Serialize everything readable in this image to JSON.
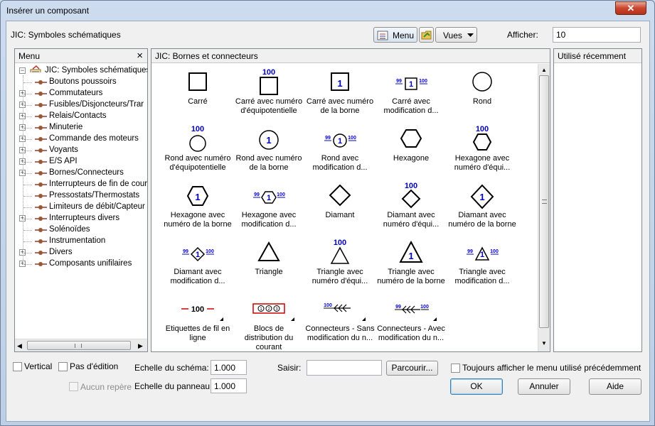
{
  "window": {
    "title": "Insérer un composant",
    "close_glyph": "✕"
  },
  "toolbar": {
    "library_label": "JIC: Symboles schématiques",
    "menu_button": "Menu",
    "views_button": "Vues",
    "show_label": "Afficher:",
    "show_value": "10"
  },
  "menu_panel": {
    "title": "Menu",
    "close_glyph": "×",
    "root": "JIC: Symboles schématiques",
    "items": [
      {
        "label": "Boutons poussoirs",
        "expandable": false
      },
      {
        "label": "Commutateurs",
        "expandable": true
      },
      {
        "label": "Fusibles/Disjoncteurs/Trar",
        "expandable": true
      },
      {
        "label": "Relais/Contacts",
        "expandable": true
      },
      {
        "label": "Minuterie",
        "expandable": true
      },
      {
        "label": "Commande des moteurs",
        "expandable": true
      },
      {
        "label": "Voyants",
        "expandable": true
      },
      {
        "label": "E/S API",
        "expandable": true
      },
      {
        "label": "Bornes/Connecteurs",
        "expandable": true
      },
      {
        "label": "Interrupteurs de fin de cour",
        "expandable": false
      },
      {
        "label": "Pressostats/Thermostats",
        "expandable": false
      },
      {
        "label": "Limiteurs de débit/Capteur",
        "expandable": false
      },
      {
        "label": "Interrupteurs divers",
        "expandable": true
      },
      {
        "label": "Solénoïdes",
        "expandable": false
      },
      {
        "label": "Instrumentation",
        "expandable": false
      },
      {
        "label": "Divers",
        "expandable": true
      },
      {
        "label": "Composants unifilaires",
        "expandable": true
      }
    ]
  },
  "symbols_panel": {
    "title": "JIC: Bornes et connecteurs",
    "symbols": [
      {
        "label": "Carré",
        "icon": "square-icon"
      },
      {
        "label": "Carré avec numéro d'équipotentielle",
        "icon": "square-100-icon"
      },
      {
        "label": "Carré avec numéro de la borne",
        "icon": "square-1-icon"
      },
      {
        "label": "Carré avec modification d...",
        "icon": "square-mod-icon"
      },
      {
        "label": "Rond",
        "icon": "circle-icon"
      },
      {
        "label": "Rond avec numéro d'équipotentielle",
        "icon": "circle-100-icon"
      },
      {
        "label": "Rond avec numéro de la borne",
        "icon": "circle-1-icon"
      },
      {
        "label": "Rond avec modification d...",
        "icon": "circle-mod-icon"
      },
      {
        "label": "Hexagone",
        "icon": "hexagon-icon"
      },
      {
        "label": "Hexagone avec numéro d'équi...",
        "icon": "hexagon-100-icon"
      },
      {
        "label": "Hexagone avec numéro de la borne",
        "icon": "hexagon-1-icon"
      },
      {
        "label": "Hexagone avec modification d...",
        "icon": "hexagon-mod-icon"
      },
      {
        "label": "Diamant",
        "icon": "diamond-icon"
      },
      {
        "label": "Diamant avec numéro d'équi...",
        "icon": "diamond-100-icon"
      },
      {
        "label": "Diamant avec numéro de la borne",
        "icon": "diamond-1-icon"
      },
      {
        "label": "Diamant avec modification d...",
        "icon": "diamond-mod-icon"
      },
      {
        "label": "Triangle",
        "icon": "triangle-icon"
      },
      {
        "label": "Triangle avec numéro d'équi...",
        "icon": "triangle-100-icon"
      },
      {
        "label": "Triangle avec numéro de la borne",
        "icon": "triangle-1-icon"
      },
      {
        "label": "Triangle avec modification d...",
        "icon": "triangle-mod-icon"
      },
      {
        "label": "Etiquettes de fil en ligne",
        "icon": "wire-label-icon"
      },
      {
        "label": "Blocs de distribution du courant",
        "icon": "distribution-block-icon"
      },
      {
        "label": "Connecteurs - Sans modification du n...",
        "icon": "connector-icon"
      },
      {
        "label": "Connecteurs - Avec modification du n...",
        "icon": "connector-mod-icon"
      }
    ],
    "glyph_100": "100",
    "glyph_99": "99",
    "glyph_1": "1",
    "glyph_wire": "–100–",
    "dist_block": [
      "1",
      "2",
      "3"
    ]
  },
  "recent_panel": {
    "title": "Utilisé récemment"
  },
  "bottom": {
    "vertical": "Vertical",
    "no_edit": "Pas d'édition",
    "no_marker": "Aucun repère",
    "schema_scale_label": "Echelle du schéma:",
    "schema_scale_value": "1.000",
    "panel_scale_label": "Echelle du panneau:",
    "panel_scale_value": "1.000",
    "enter_label": "Saisir:",
    "browse_button": "Parcourir...",
    "always_show": "Toujours afficher le menu utilisé précédemment",
    "ok": "OK",
    "cancel": "Annuler",
    "help": "Aide"
  },
  "colors": {
    "accent": "#0000cc",
    "tree_icon": "#8b3a2a",
    "dist_red": "#cc0000"
  }
}
